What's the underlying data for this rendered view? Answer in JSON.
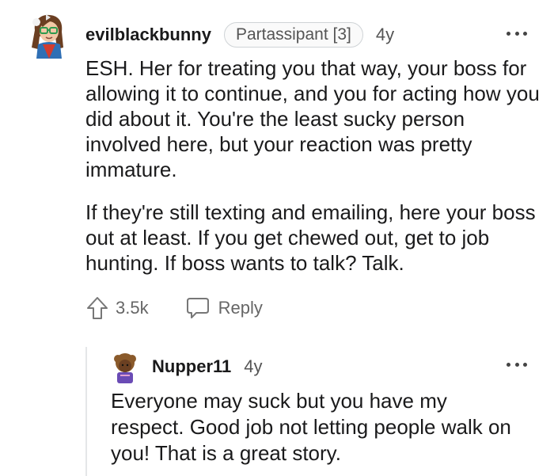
{
  "comment": {
    "username": "evilblackbunny",
    "flair": "Partassipant [3]",
    "age": "4y",
    "paragraphs": [
      "ESH. Her for treating you that way, your boss for allowing it to continue, and you for acting how you did about it. You're the least sucky person involved here, but your reaction was pretty immature.",
      "If they're still texting and emailing, here your boss out at least. If you get chewed out, get to job hunting. If boss wants to talk? Talk."
    ],
    "upvotes": "3.5k",
    "reply_label": "Reply",
    "more_icon": "more-horizontal-icon",
    "upvote_icon": "upvote-arrow-icon",
    "reply_icon": "speech-bubble-icon"
  },
  "reply": {
    "username": "Nupper11",
    "age": "4y",
    "text": "Everyone may suck but you have my respect. Good job not letting people walk on you! That is a great story.",
    "more_icon": "more-horizontal-icon"
  },
  "colors": {
    "text": "#1a1a1b",
    "meta": "#555555",
    "thread_line": "#e4e6e8"
  }
}
